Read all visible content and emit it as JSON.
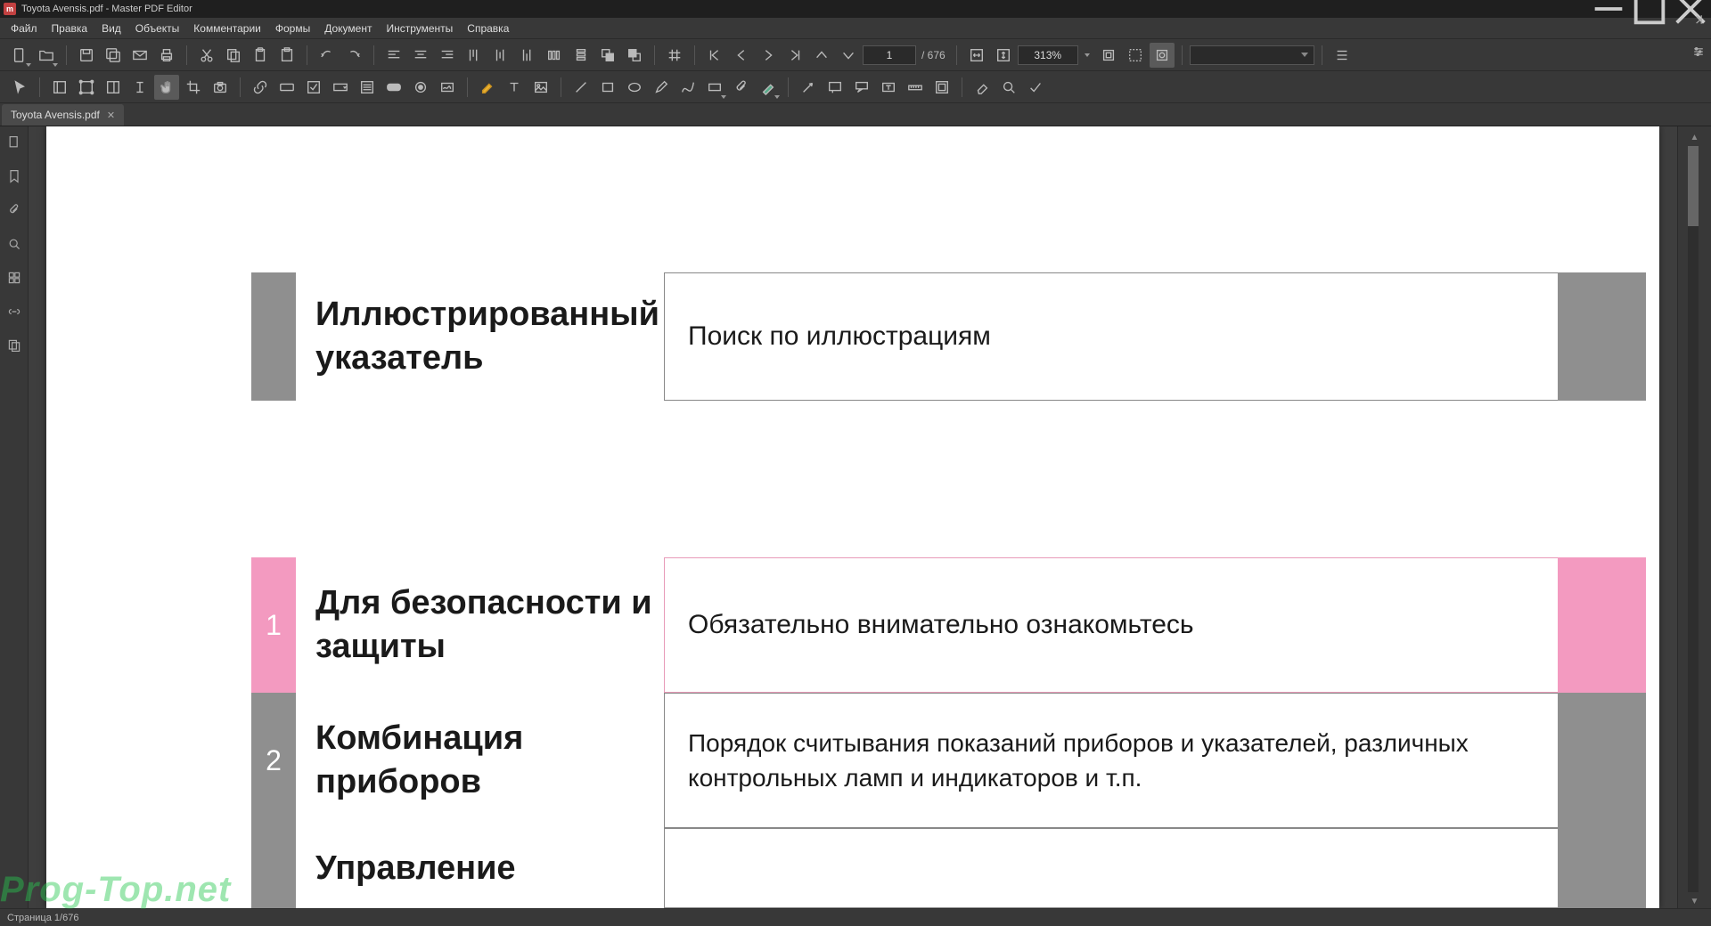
{
  "window": {
    "title": "Toyota Avensis.pdf - Master PDF Editor"
  },
  "menu": [
    "Файл",
    "Правка",
    "Вид",
    "Объекты",
    "Комментарии",
    "Формы",
    "Документ",
    "Инструменты",
    "Справка"
  ],
  "toolbar": {
    "page_input": "1",
    "page_total": "/ 676",
    "zoom": "313%"
  },
  "tab": {
    "name": "Toyota Avensis.pdf"
  },
  "status": "Страница 1/676",
  "watermark": "Prog-Top.net",
  "doc": {
    "row0": {
      "num": "",
      "title": "Иллюстрированный указатель",
      "desc": "Поиск по иллюстрациям"
    },
    "row1": {
      "num": "1",
      "title": "Для безопасности и защиты",
      "desc": "Обязательно внимательно ознакомьтесь"
    },
    "row2": {
      "num": "2",
      "title": "Комбинация приборов",
      "desc": "Порядок считывания показаний приборов и указателей, различных контрольных ламп и индикаторов и т.п."
    },
    "row3": {
      "num": "",
      "title": "Управление",
      "desc": ""
    }
  }
}
